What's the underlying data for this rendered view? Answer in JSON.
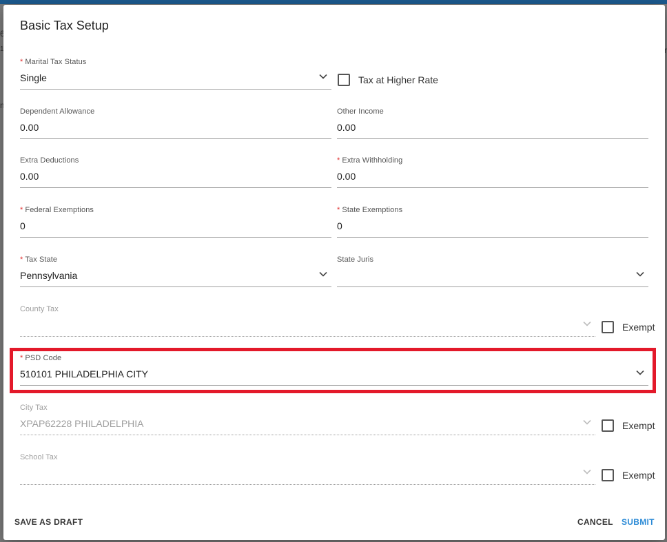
{
  "backdrop": {
    "left_char_1": "6",
    "left_char_2": "1!",
    "left_char_3": "m",
    "right_char": "r"
  },
  "dialog": {
    "title": "Basic Tax Setup",
    "required_mark": "*",
    "marital_status": {
      "label": "Marital Tax Status",
      "value": "Single",
      "required": true
    },
    "tax_higher_rate": {
      "label": "Tax at Higher Rate",
      "checked": false
    },
    "dependent_allowance": {
      "label": "Dependent Allowance",
      "value": "0.00"
    },
    "other_income": {
      "label": "Other Income",
      "value": "0.00"
    },
    "extra_deductions": {
      "label": "Extra Deductions",
      "value": "0.00"
    },
    "extra_withholding": {
      "label": "Extra Withholding",
      "value": "0.00",
      "required": true
    },
    "federal_exemptions": {
      "label": "Federal Exemptions",
      "value": "0",
      "required": true
    },
    "state_exemptions": {
      "label": "State Exemptions",
      "value": "0",
      "required": true
    },
    "tax_state": {
      "label": "Tax State",
      "value": "Pennsylvania",
      "required": true
    },
    "state_juris": {
      "label": "State Juris",
      "value": ""
    },
    "county_tax": {
      "label": "County Tax",
      "value": "",
      "disabled": true,
      "exempt_label": "Exempt",
      "exempt_checked": false
    },
    "psd_code": {
      "label": "PSD Code",
      "value": "510101 PHILADELPHIA CITY",
      "required": true
    },
    "city_tax": {
      "label": "City Tax",
      "value": "XPAP62228 PHILADELPHIA",
      "disabled": true,
      "exempt_label": "Exempt",
      "exempt_checked": false
    },
    "school_tax": {
      "label": "School Tax",
      "value": "",
      "disabled": true,
      "exempt_label": "Exempt",
      "exempt_checked": false
    },
    "buttons": {
      "save_draft": "SAVE AS DRAFT",
      "cancel": "CANCEL",
      "submit": "SUBMIT"
    }
  },
  "colors": {
    "accent": "#2b8ad6",
    "required": "#e03030",
    "highlight": "#e3192a",
    "backdrop": "#7c7c7c"
  },
  "icons": {
    "dropdown": "chevron-down-icon"
  }
}
